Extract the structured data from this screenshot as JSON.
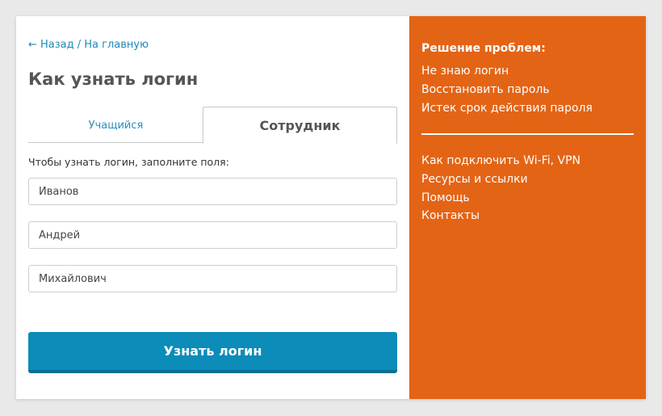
{
  "nav": {
    "back_link": "← Назад / На главную"
  },
  "page": {
    "title": "Как узнать логин"
  },
  "tabs": [
    {
      "label": "Учащийся",
      "active": false
    },
    {
      "label": "Сотрудник",
      "active": true
    }
  ],
  "form": {
    "hint": "Чтобы узнать логин, заполните поля:",
    "fields": [
      {
        "value": "Иванов"
      },
      {
        "value": "Андрей"
      },
      {
        "value": "Михайлович"
      }
    ],
    "submit_label": "Узнать логин"
  },
  "help": {
    "title": "Решение проблем:",
    "problem_links": [
      "Не знаю логин",
      "Восстановить пароль",
      "Истек срок действия пароля"
    ],
    "info_links": [
      "Как подключить Wi-Fi, VPN",
      "Ресурсы и ссылки",
      "Помощь",
      "Контакты"
    ]
  },
  "colors": {
    "accent_orange": "#e46415",
    "button_blue": "#0c8cb8",
    "link_blue": "#1e88b8",
    "background": "#e9e9e9"
  }
}
